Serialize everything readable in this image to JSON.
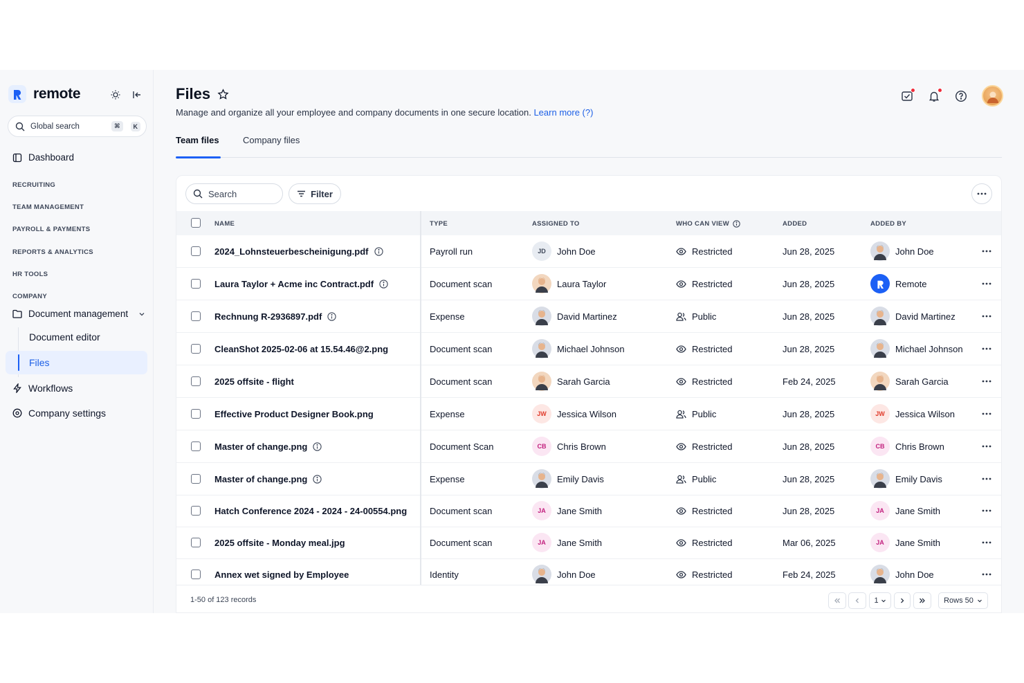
{
  "sidebar": {
    "brand": "remote",
    "search_placeholder": "Global search",
    "shortcut_mod": "⌘",
    "shortcut_key": "K",
    "dashboard": "Dashboard",
    "groups": [
      "RECRUITING",
      "TEAM MANAGEMENT",
      "PAYROLL & PAYMENTS",
      "REPORTS & ANALYTICS",
      "HR TOOLS",
      "COMPANY"
    ],
    "document_management": "Document management",
    "sub_items": [
      "Document editor",
      "Files"
    ],
    "workflows": "Workflows",
    "company_settings": "Company settings"
  },
  "header": {
    "title": "Files",
    "subtitle": "Manage and organize all your employee and company documents in one secure location.",
    "learn_more": "Learn more (?)",
    "tabs": [
      "Team files",
      "Company files"
    ]
  },
  "toolbar": {
    "search_placeholder": "Search",
    "filter_label": "Filter"
  },
  "table": {
    "columns": [
      "NAME",
      "TYPE",
      "ASSIGNED TO",
      "WHO CAN VIEW",
      "ADDED",
      "ADDED BY"
    ],
    "rows": [
      {
        "name": "2024_Lohnsteuerbescheinigung.pdf",
        "info": true,
        "type": "Payroll run",
        "assigned": "John Doe",
        "assigned_av": "initials",
        "assigned_init": "JD",
        "view": "Restricted",
        "added": "Jun 28, 2025",
        "by": "John Doe",
        "by_av": "photo"
      },
      {
        "name": "Laura Taylor + Acme inc Contract.pdf",
        "info": true,
        "type": "Document scan",
        "assigned": "Laura Taylor",
        "assigned_av": "photo-f",
        "view": "Restricted",
        "added": "Jun 28, 2025",
        "by": "Remote",
        "by_av": "brand"
      },
      {
        "name": "Rechnung R-2936897.pdf",
        "info": true,
        "type": "Expense",
        "assigned": "David Martinez",
        "assigned_av": "photo",
        "view": "Public",
        "added": "Jun 28, 2025",
        "by": "David Martinez",
        "by_av": "photo"
      },
      {
        "name": "CleanShot 2025-02-06 at 15.54.46@2.png",
        "info": false,
        "type": "Document scan",
        "assigned": "Michael Johnson",
        "assigned_av": "photo",
        "view": "Restricted",
        "added": "Jun 28, 2025",
        "by": "Michael Johnson",
        "by_av": "photo"
      },
      {
        "name": "2025 offsite - flight",
        "info": false,
        "type": "Document scan",
        "assigned": "Sarah Garcia",
        "assigned_av": "photo-f",
        "view": "Restricted",
        "added": "Feb 24, 2025",
        "by": "Sarah Garcia",
        "by_av": "photo-f"
      },
      {
        "name": "Effective Product Designer Book.png",
        "info": false,
        "type": "Expense",
        "assigned": "Jessica Wilson",
        "assigned_av": "initials-red",
        "assigned_init": "JW",
        "view": "Public",
        "added": "Jun 28, 2025",
        "by": "Jessica Wilson",
        "by_av": "initials-red",
        "by_init": "JW"
      },
      {
        "name": "Master of change.png",
        "info": true,
        "type": "Document Scan",
        "assigned": "Chris Brown",
        "assigned_av": "initials-pink",
        "assigned_init": "CB",
        "view": "Restricted",
        "added": "Jun 28, 2025",
        "by": "Chris Brown",
        "by_av": "initials-pink",
        "by_init": "CB"
      },
      {
        "name": "Master of change.png",
        "info": true,
        "type": "Expense",
        "assigned": "Emily Davis",
        "assigned_av": "photo",
        "view": "Public",
        "added": "Jun 28, 2025",
        "by": "Emily Davis",
        "by_av": "photo"
      },
      {
        "name": "Hatch Conference 2024 - 2024 - 24-00554.png",
        "info": false,
        "type": "Document scan",
        "assigned": "Jane Smith",
        "assigned_av": "initials-pink",
        "assigned_init": "JA",
        "view": "Restricted",
        "added": "Jun 28, 2025",
        "by": "Jane Smith",
        "by_av": "initials-pink",
        "by_init": "JA"
      },
      {
        "name": "2025 offsite - Monday meal.jpg",
        "info": false,
        "type": "Document scan",
        "assigned": "Jane Smith",
        "assigned_av": "initials-pink",
        "assigned_init": "JA",
        "view": "Restricted",
        "added": "Mar 06, 2025",
        "by": "Jane Smith",
        "by_av": "initials-pink",
        "by_init": "JA"
      },
      {
        "name": "Annex wet signed by Employee",
        "info": false,
        "type": "Identity",
        "assigned": "John Doe",
        "assigned_av": "photo",
        "view": "Restricted",
        "added": "Feb 24, 2025",
        "by": "John Doe",
        "by_av": "photo"
      }
    ]
  },
  "footer": {
    "records": "1-50 of 123 records",
    "page": "1",
    "rows_label": "Rows 50"
  },
  "colors": {
    "accent": "#1c60f5",
    "link": "#1c5fe6",
    "notification": "#ef2b3a"
  }
}
